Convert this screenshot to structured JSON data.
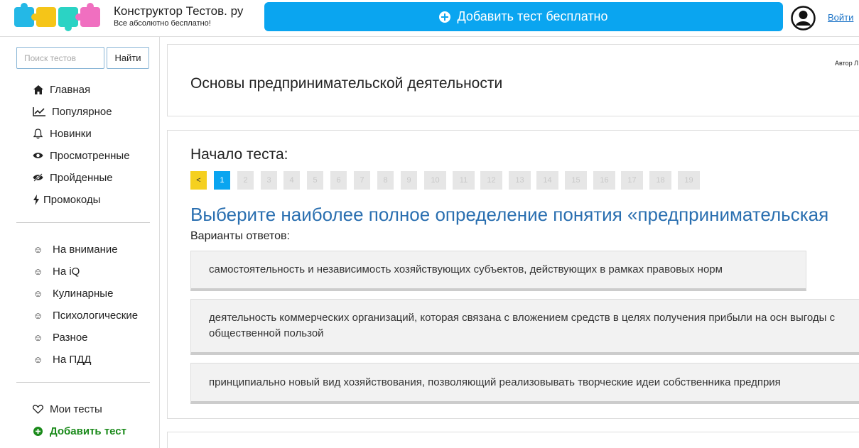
{
  "header": {
    "site_title": "Конструктор Тестов. ру",
    "site_subtitle": "Все абсолютно бесплатно!",
    "add_test_label": "Добавить тест бесплатно",
    "login_label": "Войти",
    "accent_color": "#0aa5f0"
  },
  "sidebar": {
    "search_placeholder": "Поиск тестов",
    "search_button": "Найти",
    "nav": [
      {
        "label": "Главная",
        "icon": "home-icon"
      },
      {
        "label": "Популярное",
        "icon": "chart-line-icon"
      },
      {
        "label": "Новинки",
        "icon": "bell-icon"
      },
      {
        "label": "Просмотренные",
        "icon": "eye-icon"
      },
      {
        "label": "Пройденные",
        "icon": "eye-slash-icon"
      },
      {
        "label": "Промокоды",
        "icon": "bolt-icon"
      }
    ],
    "categories": [
      {
        "label": "На внимание",
        "icon": "smile-icon"
      },
      {
        "label": "На iQ",
        "icon": "smile-icon"
      },
      {
        "label": "Кулинарные",
        "icon": "smile-icon"
      },
      {
        "label": "Психологические",
        "icon": "smile-icon"
      },
      {
        "label": "Разное",
        "icon": "smile-icon"
      },
      {
        "label": "На ПДД",
        "icon": "smile-icon"
      }
    ],
    "my_tests": "Мои тесты",
    "add_test": "Добавить тест"
  },
  "test": {
    "author": "Автор Л",
    "title": "Основы предпринимательской деятельности",
    "start_label": "Начало теста:",
    "pager": {
      "prev": "<",
      "current": 1,
      "pages": [
        "1",
        "2",
        "3",
        "4",
        "5",
        "6",
        "7",
        "8",
        "9",
        "10",
        "11",
        "12",
        "13",
        "14",
        "15",
        "16",
        "17",
        "18",
        "19"
      ]
    },
    "question": "Выберите наиболее полное определение понятия «предпринимательская",
    "answers_label": "Варианты ответов:",
    "answers": [
      "самостоятельность и независимость хозяйствующих субъектов, действующих в рамках правовых норм",
      "деятельность коммерческих организаций, которая связана с вложением средств в целях получения прибыли на осн выгоды с общественной пользой",
      "принципиально новый вид хозяйствования, позволяющий реализовывать творческие идеи собственника предприя"
    ]
  }
}
